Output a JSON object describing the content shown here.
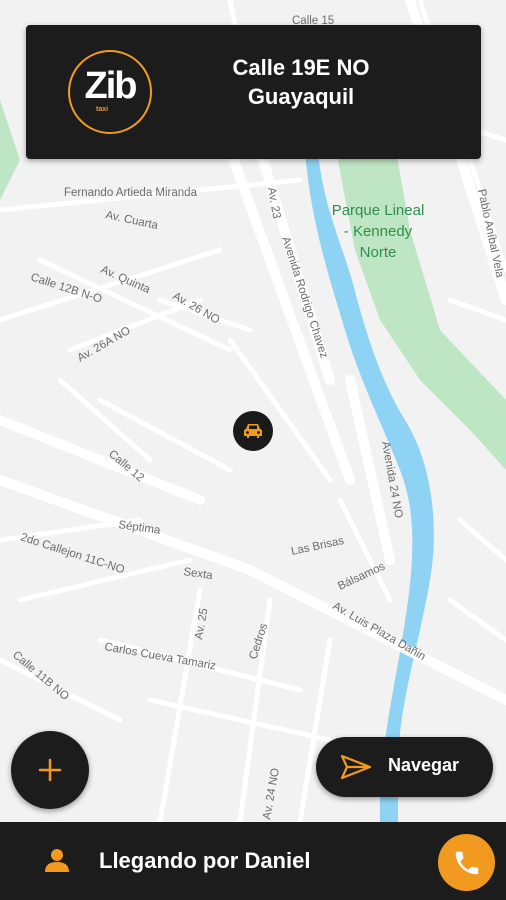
{
  "header": {
    "logo_text": "Zib",
    "logo_subtext": "taxi",
    "address_line1": "Calle 19E NO",
    "address_line2": "Guayaquil"
  },
  "map": {
    "park_label_1": "Parque Lineal",
    "park_label_2": "- Kennedy",
    "park_label_3": "Norte",
    "streets": {
      "calle15": "Calle 15",
      "fernando": "Fernando Artieda Miranda",
      "av_cuarta": "Av. Cuarta",
      "av23": "Av. 23",
      "rodrigo": "Avenida Rodrigo Chavez",
      "pablo": "Pablo Aníbal Vela",
      "calle12b": "Calle 12B N-O",
      "av_quinta": "Av. Quinta",
      "av26": "Av. 26 NO",
      "av26a": "Av. 26A NO",
      "calle12": "Calle 12",
      "av24": "Avenida 24 NO",
      "septima": "Séptima",
      "las_brisas": "Las Brisas",
      "balsamos": "Bálsamos",
      "callejon": "2do Callejon 11C-NO",
      "sexta": "Sexta",
      "luis_plaza": "Av. Luis Plaza Dañin",
      "av25": "Av. 25",
      "cedros": "Cedros",
      "carlos": "Carlos Cueva Tamariz",
      "calle11b": "Calle 11B NO",
      "av24no": "Av. 24 NO"
    }
  },
  "actions": {
    "navigate_label": "Navegar"
  },
  "status": {
    "arrival_text": "Llegando por Daniel"
  },
  "colors": {
    "accent": "#f29a1f",
    "dark": "#1c1c1c",
    "water": "#8fd3f4",
    "park": "#bfe6c4"
  },
  "icons": {
    "add": "plus-icon",
    "navigate": "send-icon",
    "person": "person-icon",
    "call": "phone-icon",
    "car": "car-icon"
  }
}
